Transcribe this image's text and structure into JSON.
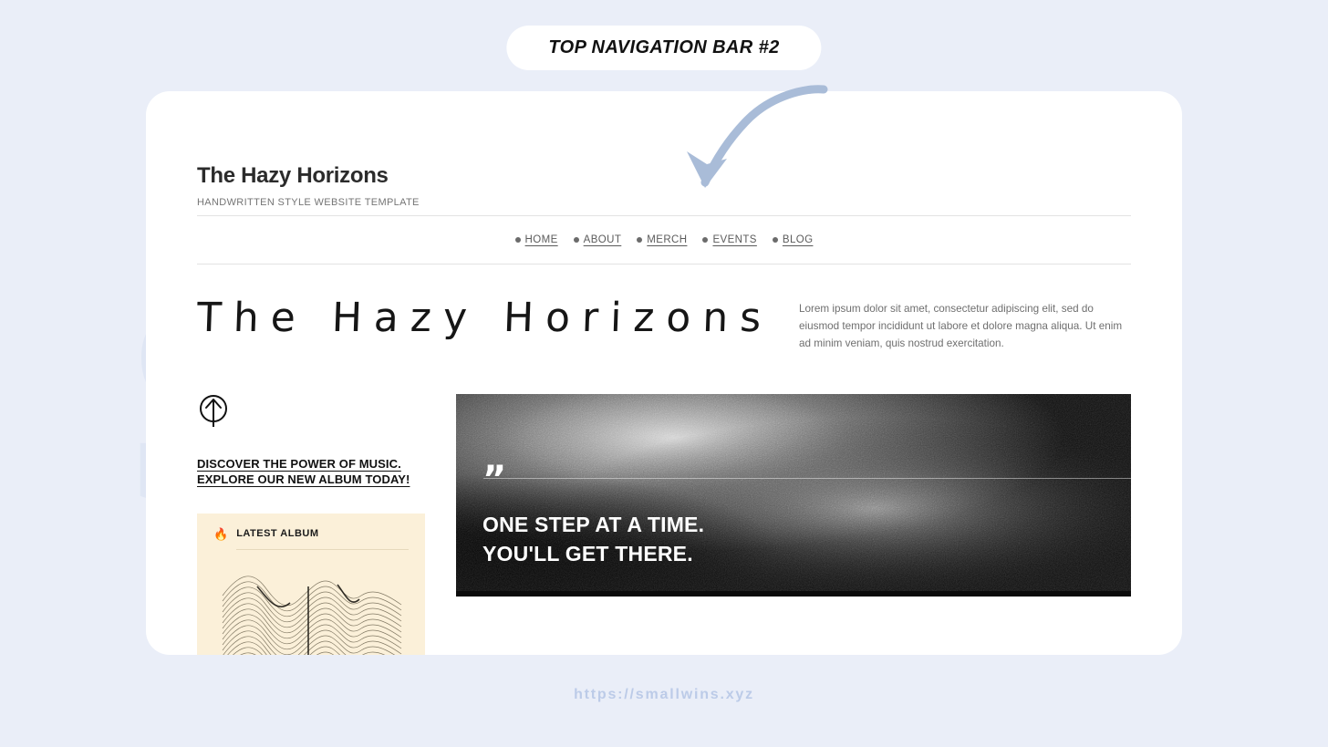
{
  "badge": {
    "label": "TOP NAVIGATION BAR #2"
  },
  "watermark": {
    "text": "SWINS"
  },
  "site": {
    "title": "The Hazy Horizons",
    "tagline": "HANDWRITTEN STYLE WEBSITE TEMPLATE"
  },
  "nav": {
    "items": [
      {
        "label": "HOME"
      },
      {
        "label": "ABOUT"
      },
      {
        "label": "MERCH"
      },
      {
        "label": "EVENTS"
      },
      {
        "label": "BLOG"
      }
    ]
  },
  "hero": {
    "headline": "The Hazy Horizons",
    "paragraph": "Lorem ipsum dolor sit amet, consectetur adipiscing elit, sed do eiusmod tempor incididunt ut labore et dolore magna aliqua. Ut enim ad minim veniam, quis nostrud exercitation."
  },
  "cta": {
    "icon": "arrow-up-in-circle-icon",
    "line1": "DISCOVER THE POWER OF MUSIC.",
    "line2": "EXPLORE OUR NEW ALBUM TODAY!"
  },
  "album": {
    "icon": "fire-icon",
    "icon_glyph": "🔥",
    "label": "LATEST ALBUM"
  },
  "quote": {
    "mark": "”",
    "line1": "ONE STEP AT A TIME.",
    "line2": "YOU'LL GET THERE."
  },
  "footer": {
    "url": "https://smallwins.xyz"
  },
  "colors": {
    "page_background": "#eaeef8",
    "card_background": "#ffffff",
    "watermark": "#dfe6f4",
    "album_panel": "#fbf0d9",
    "footer_url": "#bccbe8",
    "arrow": "#a9bcd8",
    "quote_background": "#0b0b0b",
    "fire_icon": "#d93b2b"
  }
}
